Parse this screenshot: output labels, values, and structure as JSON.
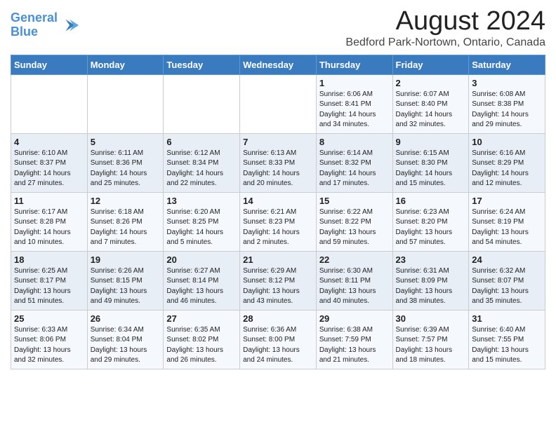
{
  "logo": {
    "line1": "General",
    "line2": "Blue"
  },
  "title": "August 2024",
  "location": "Bedford Park-Nortown, Ontario, Canada",
  "days_of_week": [
    "Sunday",
    "Monday",
    "Tuesday",
    "Wednesday",
    "Thursday",
    "Friday",
    "Saturday"
  ],
  "weeks": [
    [
      {
        "day": "",
        "info": ""
      },
      {
        "day": "",
        "info": ""
      },
      {
        "day": "",
        "info": ""
      },
      {
        "day": "",
        "info": ""
      },
      {
        "day": "1",
        "info": "Sunrise: 6:06 AM\nSunset: 8:41 PM\nDaylight: 14 hours\nand 34 minutes."
      },
      {
        "day": "2",
        "info": "Sunrise: 6:07 AM\nSunset: 8:40 PM\nDaylight: 14 hours\nand 32 minutes."
      },
      {
        "day": "3",
        "info": "Sunrise: 6:08 AM\nSunset: 8:38 PM\nDaylight: 14 hours\nand 29 minutes."
      }
    ],
    [
      {
        "day": "4",
        "info": "Sunrise: 6:10 AM\nSunset: 8:37 PM\nDaylight: 14 hours\nand 27 minutes."
      },
      {
        "day": "5",
        "info": "Sunrise: 6:11 AM\nSunset: 8:36 PM\nDaylight: 14 hours\nand 25 minutes."
      },
      {
        "day": "6",
        "info": "Sunrise: 6:12 AM\nSunset: 8:34 PM\nDaylight: 14 hours\nand 22 minutes."
      },
      {
        "day": "7",
        "info": "Sunrise: 6:13 AM\nSunset: 8:33 PM\nDaylight: 14 hours\nand 20 minutes."
      },
      {
        "day": "8",
        "info": "Sunrise: 6:14 AM\nSunset: 8:32 PM\nDaylight: 14 hours\nand 17 minutes."
      },
      {
        "day": "9",
        "info": "Sunrise: 6:15 AM\nSunset: 8:30 PM\nDaylight: 14 hours\nand 15 minutes."
      },
      {
        "day": "10",
        "info": "Sunrise: 6:16 AM\nSunset: 8:29 PM\nDaylight: 14 hours\nand 12 minutes."
      }
    ],
    [
      {
        "day": "11",
        "info": "Sunrise: 6:17 AM\nSunset: 8:28 PM\nDaylight: 14 hours\nand 10 minutes."
      },
      {
        "day": "12",
        "info": "Sunrise: 6:18 AM\nSunset: 8:26 PM\nDaylight: 14 hours\nand 7 minutes."
      },
      {
        "day": "13",
        "info": "Sunrise: 6:20 AM\nSunset: 8:25 PM\nDaylight: 14 hours\nand 5 minutes."
      },
      {
        "day": "14",
        "info": "Sunrise: 6:21 AM\nSunset: 8:23 PM\nDaylight: 14 hours\nand 2 minutes."
      },
      {
        "day": "15",
        "info": "Sunrise: 6:22 AM\nSunset: 8:22 PM\nDaylight: 13 hours\nand 59 minutes."
      },
      {
        "day": "16",
        "info": "Sunrise: 6:23 AM\nSunset: 8:20 PM\nDaylight: 13 hours\nand 57 minutes."
      },
      {
        "day": "17",
        "info": "Sunrise: 6:24 AM\nSunset: 8:19 PM\nDaylight: 13 hours\nand 54 minutes."
      }
    ],
    [
      {
        "day": "18",
        "info": "Sunrise: 6:25 AM\nSunset: 8:17 PM\nDaylight: 13 hours\nand 51 minutes."
      },
      {
        "day": "19",
        "info": "Sunrise: 6:26 AM\nSunset: 8:15 PM\nDaylight: 13 hours\nand 49 minutes."
      },
      {
        "day": "20",
        "info": "Sunrise: 6:27 AM\nSunset: 8:14 PM\nDaylight: 13 hours\nand 46 minutes."
      },
      {
        "day": "21",
        "info": "Sunrise: 6:29 AM\nSunset: 8:12 PM\nDaylight: 13 hours\nand 43 minutes."
      },
      {
        "day": "22",
        "info": "Sunrise: 6:30 AM\nSunset: 8:11 PM\nDaylight: 13 hours\nand 40 minutes."
      },
      {
        "day": "23",
        "info": "Sunrise: 6:31 AM\nSunset: 8:09 PM\nDaylight: 13 hours\nand 38 minutes."
      },
      {
        "day": "24",
        "info": "Sunrise: 6:32 AM\nSunset: 8:07 PM\nDaylight: 13 hours\nand 35 minutes."
      }
    ],
    [
      {
        "day": "25",
        "info": "Sunrise: 6:33 AM\nSunset: 8:06 PM\nDaylight: 13 hours\nand 32 minutes."
      },
      {
        "day": "26",
        "info": "Sunrise: 6:34 AM\nSunset: 8:04 PM\nDaylight: 13 hours\nand 29 minutes."
      },
      {
        "day": "27",
        "info": "Sunrise: 6:35 AM\nSunset: 8:02 PM\nDaylight: 13 hours\nand 26 minutes."
      },
      {
        "day": "28",
        "info": "Sunrise: 6:36 AM\nSunset: 8:00 PM\nDaylight: 13 hours\nand 24 minutes."
      },
      {
        "day": "29",
        "info": "Sunrise: 6:38 AM\nSunset: 7:59 PM\nDaylight: 13 hours\nand 21 minutes."
      },
      {
        "day": "30",
        "info": "Sunrise: 6:39 AM\nSunset: 7:57 PM\nDaylight: 13 hours\nand 18 minutes."
      },
      {
        "day": "31",
        "info": "Sunrise: 6:40 AM\nSunset: 7:55 PM\nDaylight: 13 hours\nand 15 minutes."
      }
    ]
  ]
}
